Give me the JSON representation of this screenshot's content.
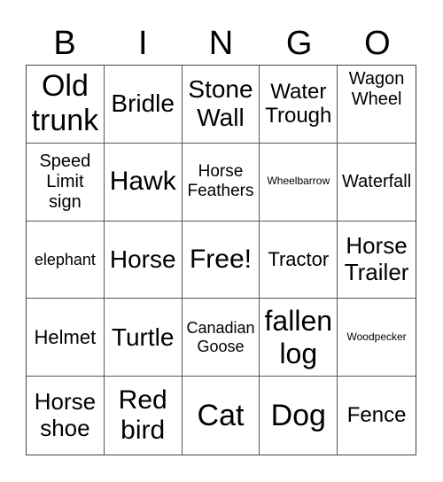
{
  "header": [
    "B",
    "I",
    "N",
    "G",
    "O"
  ],
  "cells": [
    [
      "Old trunk",
      "Bridle",
      "Stone Wall",
      "Water Trough",
      "Wagon Wheel"
    ],
    [
      "Speed Limit sign",
      "Hawk",
      "Horse Feathers",
      "Wheelbarrow",
      "Waterfall"
    ],
    [
      "elephant",
      "Horse",
      "Free!",
      "Tractor",
      "Horse Trailer"
    ],
    [
      "Helmet",
      "Turtle",
      "Canadian Goose",
      "fallen log",
      "Woodpecker"
    ],
    [
      "Horse shoe",
      "Red bird",
      "Cat",
      "Dog",
      "Fence"
    ]
  ],
  "free_space": "Free!"
}
